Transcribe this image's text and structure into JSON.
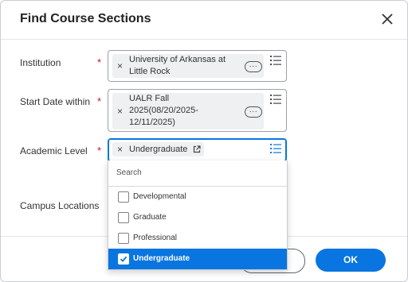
{
  "dialog": {
    "title": "Find Course Sections"
  },
  "fields": {
    "institution": {
      "label": "Institution",
      "required_mark": "*",
      "value_line1": "University of Arkansas at",
      "value_line2": "Little Rock",
      "more_label": "···"
    },
    "start_date": {
      "label": "Start Date within",
      "required_mark": "*",
      "value_line1": "UALR Fall",
      "value_line2": "2025(08/20/2025-",
      "value_line3": "12/11/2025)",
      "more_label": "···"
    },
    "academic_level": {
      "label": "Academic Level",
      "required_mark": "*",
      "value": "Undergraduate"
    },
    "campus_locations": {
      "label": "Campus Locations"
    }
  },
  "dropdown": {
    "search_placeholder": "Search",
    "options": [
      {
        "label": "Developmental",
        "checked": false
      },
      {
        "label": "Graduate",
        "checked": false
      },
      {
        "label": "Professional",
        "checked": false
      },
      {
        "label": "Undergraduate",
        "checked": true
      }
    ]
  },
  "buttons": {
    "ok_label": "OK"
  },
  "colors": {
    "accent": "#0875e1",
    "required": "#c8102e"
  },
  "icons": {
    "close": "close-icon",
    "remove": "x-icon",
    "list": "list-icon",
    "external_link": "external-link-icon",
    "checkmark": "checkmark-icon"
  }
}
